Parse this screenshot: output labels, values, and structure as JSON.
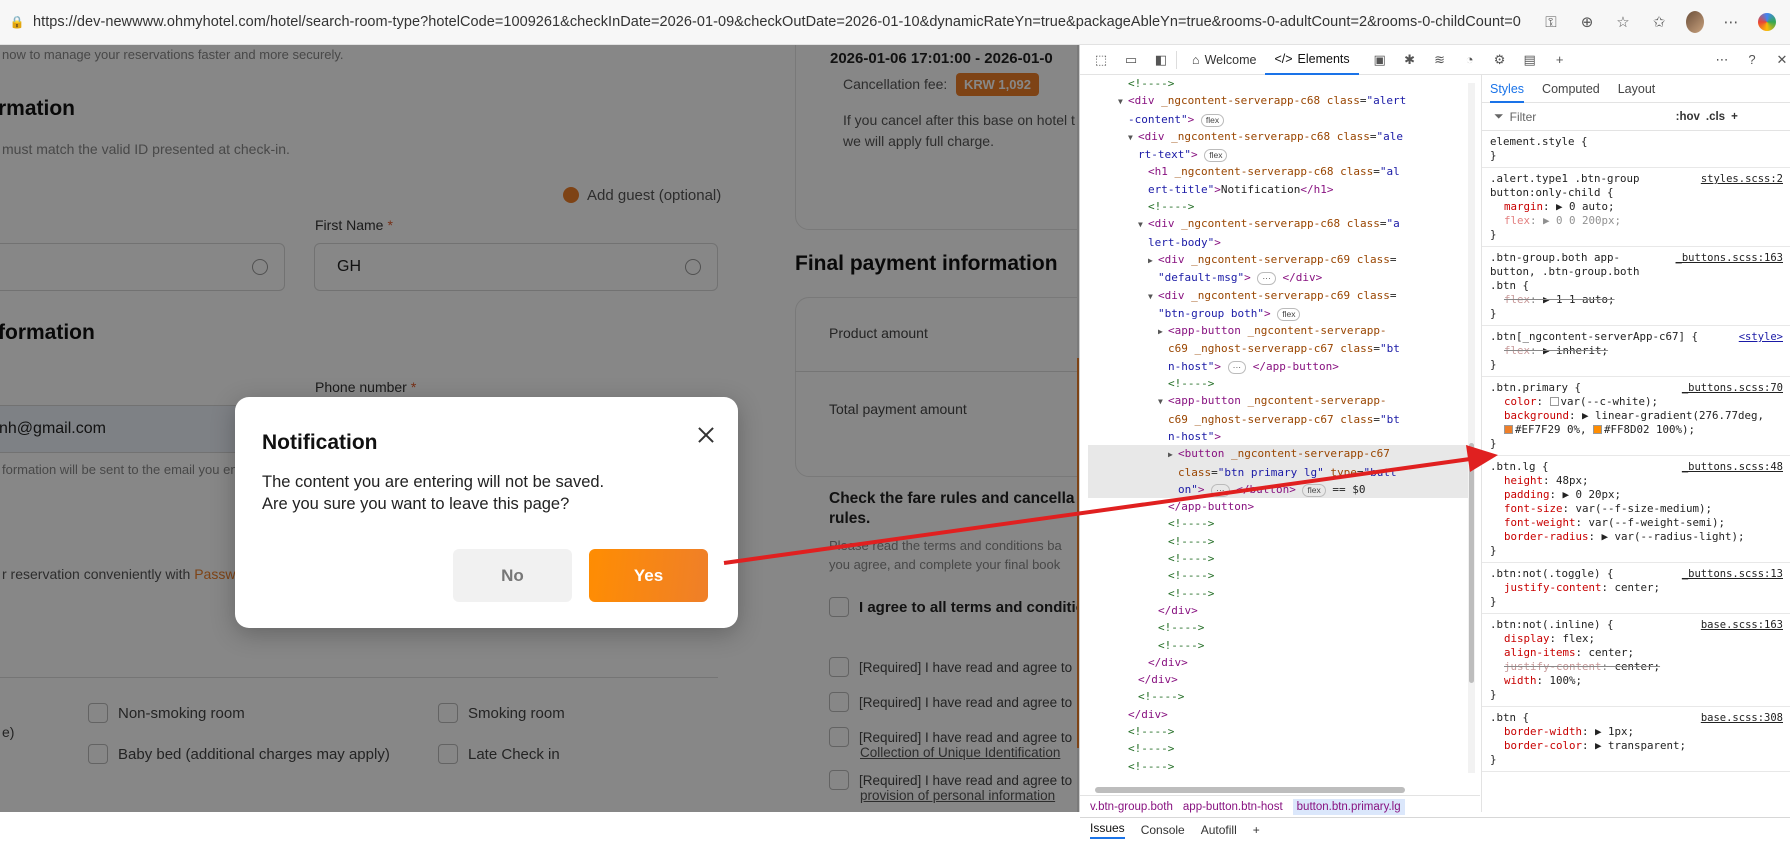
{
  "browser": {
    "url": "https://dev-newwww.ohmyhotel.com/hotel/search-room-type?hotelCode=1009261&checkInDate=2026-01-09&checkOutDate=2026-01-10&dynamicRateYn=true&packageAbleYn=true&rooms-0-adultCount=2&rooms-0-childCount=0",
    "toolbar_icons": [
      "key-icon",
      "zoom-icon",
      "star-icon",
      "favorites-icon",
      "profile-avatar",
      "more-icon",
      "copilot-icon"
    ]
  },
  "page": {
    "intro_text": "now to manage your reservations faster and more securely.",
    "section_guest": "rmation",
    "id_note": "must match the valid ID presented at check-in.",
    "add_guest": "Add guest (optional)",
    "first_name_label": "First Name",
    "first_name_value": "GH",
    "section_contact": "formation",
    "phone_label": "Phone number",
    "email_value": "nh@gmail.com",
    "email_note": "formation will be sent to the email you ent",
    "reservation_note": "r reservation conveniently with",
    "reservation_link": "Passw",
    "pref_label": "e)",
    "checkboxes": [
      "Non-smoking room",
      "Smoking room",
      "Baby bed (additional charges may apply)",
      "Late Check in"
    ],
    "cancel_date": "2026-01-06 17:01:00 - 2026-01-0",
    "cancel_fee_label": "Cancellation fee:",
    "cancel_fee_value": "KRW 1,092",
    "cancel_note_1": "If you cancel after this base on hotel t",
    "cancel_note_2": "we will apply full charge.",
    "final_payment_title": "Final payment information",
    "product_amount": "Product amount",
    "total_payment": "Total payment amount",
    "fare_rules_title_1": "Check the fare rules and cancella",
    "fare_rules_title_2": "rules.",
    "fare_rules_desc_1": "Please read the terms and conditions ba",
    "fare_rules_desc_2": "you agree, and complete your final book",
    "agree_all": "I agree to all terms and conditions",
    "required_items": [
      "[Required] I have read and agree to",
      "[Required] I have read and agree to",
      "[Required] I have read and agree to",
      "Collection of Unique Identification",
      "[Required] I have read and agree to",
      "provision of personal information"
    ]
  },
  "modal": {
    "title": "Notification",
    "message_line1": "The content you are entering will not be saved.",
    "message_line2": "Are you sure you want to leave this page?",
    "no_label": "No",
    "yes_label": "Yes",
    "yes_gradient": [
      "#EF7F29",
      "#FF8D02"
    ]
  },
  "devtools": {
    "tabs": [
      "Welcome",
      "Elements"
    ],
    "active_tab": "Elements",
    "breadcrumbs": [
      "v.btn-group.both",
      "app-button.btn-host",
      "button.btn.primary.lg"
    ],
    "styles_tabs": [
      "Styles",
      "Computed",
      "Layout"
    ],
    "filter_placeholder": "Filter",
    "filter_opts": [
      ":hov",
      ".cls"
    ],
    "bottom_tabs": [
      "Issues",
      "Console",
      "Autofill"
    ],
    "dom_lines": [
      {
        "indent": 6,
        "html": "<span class='cmt'>&lt;!----&gt;</span>"
      },
      {
        "indent": 5,
        "html": "<span class='tri'>▼</span><span class='tag'>&lt;div</span> <span class='attr'>_ngcontent-serverapp-c68</span> <span class='attr'>class</span>=<span class='val'>\"alert</span>"
      },
      {
        "indent": 6,
        "html": "<span class='val'>-content\"</span><span class='tag'>&gt;</span> <span class='pill'>flex</span>"
      },
      {
        "indent": 6,
        "html": "<span class='tri'>▼</span><span class='tag'>&lt;div</span> <span class='attr'>_ngcontent-serverapp-c68</span> <span class='attr'>class</span>=<span class='val'>\"ale</span>"
      },
      {
        "indent": 7,
        "html": "<span class='val'>rt-text\"</span><span class='tag'>&gt;</span> <span class='pill'>flex</span>"
      },
      {
        "indent": 8,
        "html": "<span class='tag'>&lt;h1</span> <span class='attr'>_ngcontent-serverapp-c68</span> <span class='attr'>class</span>=<span class='val'>\"al</span>"
      },
      {
        "indent": 8,
        "html": "<span class='val'>ert-title\"</span><span class='tag'>&gt;</span><span class='txt'>Notification</span><span class='tag'>&lt;/h1&gt;</span>"
      },
      {
        "indent": 8,
        "html": "<span class='cmt'>&lt;!----&gt;</span>"
      },
      {
        "indent": 7,
        "html": "<span class='tri'>▼</span><span class='tag'>&lt;div</span> <span class='attr'>_ngcontent-serverapp-c68</span> <span class='attr'>class</span>=<span class='val'>\"a</span>"
      },
      {
        "indent": 8,
        "html": "<span class='val'>lert-body\"</span><span class='tag'>&gt;</span>"
      },
      {
        "indent": 8,
        "html": "<span class='tri'>▶</span><span class='tag'>&lt;div</span> <span class='attr'>_ngcontent-serverapp-c69</span> <span class='attr'>class</span>="
      },
      {
        "indent": 9,
        "html": "<span class='val'>\"default-msg\"</span><span class='tag'>&gt;</span> <span class='pill'>···</span> <span class='tag'>&lt;/div&gt;</span>"
      },
      {
        "indent": 8,
        "html": "<span class='tri'>▼</span><span class='tag'>&lt;div</span> <span class='attr'>_ngcontent-serverapp-c69</span> <span class='attr'>class</span>="
      },
      {
        "indent": 9,
        "html": "<span class='val'>\"btn-group both\"</span><span class='tag'>&gt;</span> <span class='pill'>flex</span>"
      },
      {
        "indent": 9,
        "html": "<span class='tri'>▶</span><span class='tag'>&lt;app-button</span> <span class='attr'>_ngcontent-serverapp-</span>"
      },
      {
        "indent": 10,
        "html": "<span class='attr'>c69 _nghost-serverapp-c67</span> <span class='attr'>class</span>=<span class='val'>\"bt</span>"
      },
      {
        "indent": 10,
        "html": "<span class='val'>n-host\"</span><span class='tag'>&gt;</span> <span class='pill'>···</span> <span class='tag'>&lt;/app-button&gt;</span>"
      },
      {
        "indent": 10,
        "html": "<span class='cmt'>&lt;!----&gt;</span>"
      },
      {
        "indent": 9,
        "html": "<span class='tri'>▼</span><span class='tag'>&lt;app-button</span> <span class='attr'>_ngcontent-serverapp-</span>"
      },
      {
        "indent": 10,
        "html": "<span class='attr'>c69 _nghost-serverapp-c67</span> <span class='attr'>class</span>=<span class='val'>\"bt</span>"
      },
      {
        "indent": 10,
        "html": "<span class='val'>n-host\"</span><span class='tag'>&gt;</span>"
      },
      {
        "indent": 10,
        "sel": true,
        "html": "<span class='tri'>▶</span><span class='tag'>&lt;button</span> <span class='attr'>_ngcontent-serverapp-c67</span>"
      },
      {
        "indent": 11,
        "sel": true,
        "html": "<span class='attr'>class</span>=<span class='val'>\"btn primary lg\"</span> <span class='attr'>type</span>=<span class='val'>\"butt</span>"
      },
      {
        "indent": 11,
        "sel": true,
        "html": "<span class='val'>on\"</span><span class='tag'>&gt;</span> <span class='pill'>···</span> <span class='tag'>&lt;/button&gt;</span> <span class='pill'>flex</span> <span class='txt'>== $0</span>"
      },
      {
        "indent": 10,
        "html": "<span class='tag'>&lt;/app-button&gt;</span>"
      },
      {
        "indent": 10,
        "html": "<span class='cmt'>&lt;!----&gt;</span>"
      },
      {
        "indent": 10,
        "html": "<span class='cmt'>&lt;!----&gt;</span>"
      },
      {
        "indent": 10,
        "html": "<span class='cmt'>&lt;!----&gt;</span>"
      },
      {
        "indent": 10,
        "html": "<span class='cmt'>&lt;!----&gt;</span>"
      },
      {
        "indent": 10,
        "html": "<span class='cmt'>&lt;!----&gt;</span>"
      },
      {
        "indent": 9,
        "html": "<span class='tag'>&lt;/div&gt;</span>"
      },
      {
        "indent": 9,
        "html": "<span class='cmt'>&lt;!----&gt;</span>"
      },
      {
        "indent": 9,
        "html": "<span class='cmt'>&lt;!----&gt;</span>"
      },
      {
        "indent": 8,
        "html": "<span class='tag'>&lt;/div&gt;</span>"
      },
      {
        "indent": 7,
        "html": "<span class='tag'>&lt;/div&gt;</span>"
      },
      {
        "indent": 7,
        "html": "<span class='cmt'>&lt;!----&gt;</span>"
      },
      {
        "indent": 6,
        "html": "<span class='tag'>&lt;/div&gt;</span>"
      },
      {
        "indent": 6,
        "html": "<span class='cmt'>&lt;!----&gt;</span>"
      },
      {
        "indent": 6,
        "html": "<span class='cmt'>&lt;!----&gt;</span>"
      },
      {
        "indent": 6,
        "html": "<span class='cmt'>&lt;!----&gt;</span>"
      }
    ],
    "rules": [
      {
        "selector": "element.style {",
        "source": "",
        "decls": []
      },
      {
        "selector": ".alert.type1 .btn-group\nbutton:only-child {",
        "source": "styles.scss:2",
        "decls": [
          {
            "p": "margin",
            "v": "▶ 0 auto;"
          },
          {
            "p": "flex",
            "v": "▶ 0 0 200px;",
            "faded": true
          }
        ]
      },
      {
        "selector": ".btn-group.both app-\nbutton, .btn-group.both\n.btn {",
        "source": "_buttons.scss:163",
        "decls": [
          {
            "p": "flex",
            "v": "▶ 1 1 auto;",
            "struck": true
          }
        ]
      },
      {
        "selector": ".btn[_ngcontent-serverApp-c67] {",
        "source": "<style>",
        "blue": true,
        "decls": [
          {
            "p": "flex",
            "v": "▶ inherit;",
            "struck": true
          }
        ]
      },
      {
        "selector": ".btn.primary {",
        "source": "_buttons.scss:70",
        "decls": [
          {
            "p": "color",
            "v": "var(--c-white);",
            "swatch": "#ffffff"
          },
          {
            "p": "background",
            "v": "▶ linear-gradient(276.77deg,",
            "swatch": ""
          },
          {
            "p": "",
            "v": "#EF7F29 0%, #FF8D02 100%);",
            "swatch": "#EF7F29"
          }
        ]
      },
      {
        "selector": ".btn.lg {",
        "source": "_buttons.scss:48",
        "decls": [
          {
            "p": "height",
            "v": "48px;"
          },
          {
            "p": "padding",
            "v": "▶ 0 20px;"
          },
          {
            "p": "font-size",
            "v": "var(--f-size-medium);"
          },
          {
            "p": "font-weight",
            "v": "var(--f-weight-semi);"
          },
          {
            "p": "border-radius",
            "v": "▶ var(--radius-light);"
          }
        ]
      },
      {
        "selector": ".btn:not(.toggle) {",
        "source": "_buttons.scss:13",
        "decls": [
          {
            "p": "justify-content",
            "v": "center;"
          }
        ]
      },
      {
        "selector": ".btn:not(.inline) {",
        "source": "base.scss:163",
        "decls": [
          {
            "p": "display",
            "v": "flex;"
          },
          {
            "p": "align-items",
            "v": "center;"
          },
          {
            "p": "justify-content",
            "v": "center;",
            "struck": true
          },
          {
            "p": "width",
            "v": "100%;"
          }
        ]
      },
      {
        "selector": ".btn {",
        "source": "base.scss:308",
        "decls": [
          {
            "p": "border-width",
            "v": "▶ 1px;"
          },
          {
            "p": "border-color",
            "v": "▶ transparent;"
          }
        ]
      }
    ]
  }
}
